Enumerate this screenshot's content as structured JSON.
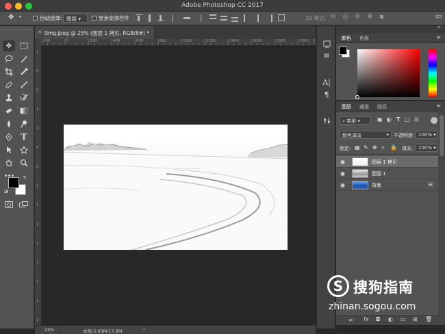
{
  "window": {
    "title": "Adobe Photoshop CC 2017"
  },
  "options_bar": {
    "auto_select_label": "自动选择:",
    "auto_select_value": "图层",
    "show_transform_label": "显示变换控件",
    "mode_3d_label": "3D 模式:"
  },
  "document": {
    "tab_title": "timg.jpeg @ 25% (图层 1 拷贝, RGB/8#) *",
    "zoom": "25%",
    "doc_size": "文档:5.93M/17.8M"
  },
  "ruler": {
    "top_ticks": [
      "200",
      "0",
      "200",
      "400",
      "600",
      "800",
      "1000",
      "1200",
      "1400",
      "1600",
      "1800",
      "2000",
      "2200"
    ],
    "left_ticks": [
      "2",
      "0",
      "0",
      "2",
      "4",
      "6",
      "8",
      "1",
      "1",
      "1",
      "1",
      "1",
      "2",
      "2",
      "2"
    ]
  },
  "color_panel": {
    "tabs": [
      "颜色",
      "色板"
    ],
    "fg_color": "#000000",
    "bg_color": "#ffffff",
    "hue_color": "#ff0000"
  },
  "layers_panel": {
    "tabs": [
      "图层",
      "通道",
      "路径"
    ],
    "filter_label": "类型",
    "blend_mode": "颜色减淡",
    "opacity_label": "不透明度:",
    "opacity_value": "100%",
    "lock_label": "锁定:",
    "fill_label": "填充:",
    "fill_value": "100%",
    "layers": [
      {
        "name": "图层 1 拷贝",
        "selected": true
      },
      {
        "name": "图层 1",
        "selected": false
      },
      {
        "name": "背景",
        "selected": false,
        "locked": true
      }
    ],
    "footer_fx": "fx"
  },
  "watermark": {
    "logo_letter": "S",
    "brand": "搜狗指南",
    "url": "zhinan.sogou.com"
  }
}
